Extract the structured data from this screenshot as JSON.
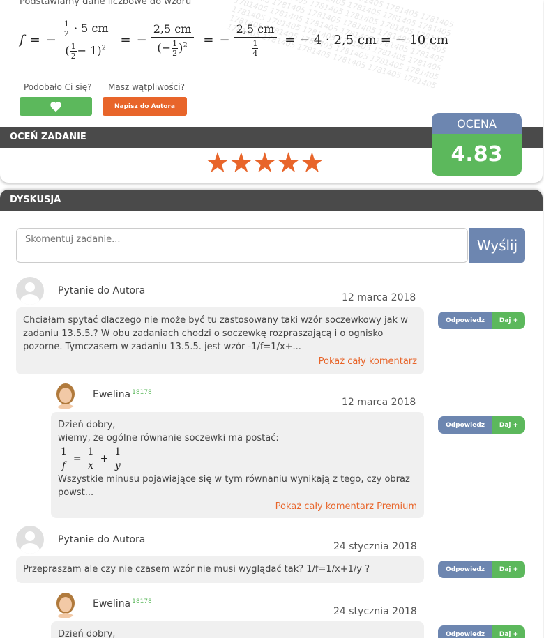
{
  "solution": {
    "intro": "Podstawiamy dane liczbowe do wzoru",
    "formula": {
      "f": "f",
      "eq": "=",
      "minus": "−",
      "half_num": "1",
      "half_den": "2",
      "five_cm": "· 5 cm",
      "paren_open": "(",
      "minus_one": "− 1)",
      "two": "2",
      "num_25": "2,5 cm",
      "quarter_num": "1",
      "quarter_den": "4",
      "tail": "= − 4 · 2,5 cm = − 10 cm"
    },
    "watermark": "1781405 1781405 1781405 1781405 1781405 1781405"
  },
  "feedback": {
    "like_question": "Podobało Ci się?",
    "doubt_question": "Masz wątpliwości?",
    "author_button": "Napisz do Autora"
  },
  "rating": {
    "bar_title": "OCEŃ ZADANIE",
    "stars": "★★★★★",
    "ocena_label": "OCENA",
    "ocena_value": "4.83"
  },
  "discussion": {
    "bar_title": "DYSKUSJA",
    "input_placeholder": "Skomentuj zadanie...",
    "send_label": "Wyślij",
    "reply_label": "Odpowiedz",
    "give_label": "Daj +",
    "comments": [
      {
        "author": "Pytanie do Autora",
        "date": "12 marca 2018",
        "text": "Chciałam spytać dlaczego nie może być tu zastosowany taki wzór soczewkowy jak w zadaniu 13.5.5.? W obu zadaniach chodzi o soczewkę rozpraszającą i o ognisko pozorne. Tymczasem w zadaniu 13.5.5. jest wzór -1/f=1/x+...",
        "more": "Pokaż cały komentarz"
      },
      {
        "author": "Ewelina",
        "badge": "18178",
        "date": "12 marca 2018",
        "line1": "Dzień dobry,",
        "line2": "wiemy, że ogólne równanie soczewki ma postać:",
        "eq_one": "1",
        "eq_f": "f",
        "eq_x": "x",
        "eq_y": "y",
        "eq_equals": "=",
        "eq_plus": "+",
        "line3": "Wszystkie minusu pojawiające się w tym równaniu wynikają z tego, czy obraz powst...",
        "more": "Pokaż cały komentarz Premium"
      },
      {
        "author": "Pytanie do Autora",
        "date": "24 stycznia 2018",
        "text": "Przepraszam ale czy nie czasem wzór nie musi wyglądać tak? 1/f=1/x+1/y ?"
      },
      {
        "author": "Ewelina",
        "badge": "18178",
        "date": "24 stycznia 2018",
        "line1": "Dzień dobry,"
      }
    ]
  }
}
